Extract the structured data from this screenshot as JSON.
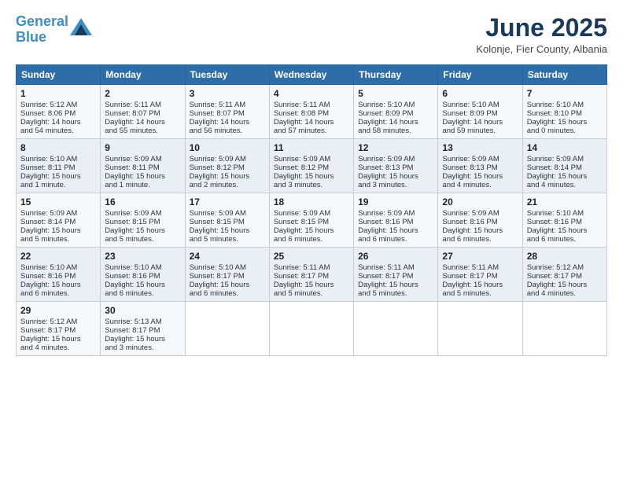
{
  "header": {
    "logo_line1": "General",
    "logo_line2": "Blue",
    "month": "June 2025",
    "location": "Kolonje, Fier County, Albania"
  },
  "days_of_week": [
    "Sunday",
    "Monday",
    "Tuesday",
    "Wednesday",
    "Thursday",
    "Friday",
    "Saturday"
  ],
  "weeks": [
    [
      {
        "day": "1",
        "lines": [
          "Sunrise: 5:12 AM",
          "Sunset: 8:06 PM",
          "Daylight: 14 hours",
          "and 54 minutes."
        ]
      },
      {
        "day": "2",
        "lines": [
          "Sunrise: 5:11 AM",
          "Sunset: 8:07 PM",
          "Daylight: 14 hours",
          "and 55 minutes."
        ]
      },
      {
        "day": "3",
        "lines": [
          "Sunrise: 5:11 AM",
          "Sunset: 8:07 PM",
          "Daylight: 14 hours",
          "and 56 minutes."
        ]
      },
      {
        "day": "4",
        "lines": [
          "Sunrise: 5:11 AM",
          "Sunset: 8:08 PM",
          "Daylight: 14 hours",
          "and 57 minutes."
        ]
      },
      {
        "day": "5",
        "lines": [
          "Sunrise: 5:10 AM",
          "Sunset: 8:09 PM",
          "Daylight: 14 hours",
          "and 58 minutes."
        ]
      },
      {
        "day": "6",
        "lines": [
          "Sunrise: 5:10 AM",
          "Sunset: 8:09 PM",
          "Daylight: 14 hours",
          "and 59 minutes."
        ]
      },
      {
        "day": "7",
        "lines": [
          "Sunrise: 5:10 AM",
          "Sunset: 8:10 PM",
          "Daylight: 15 hours",
          "and 0 minutes."
        ]
      }
    ],
    [
      {
        "day": "8",
        "lines": [
          "Sunrise: 5:10 AM",
          "Sunset: 8:11 PM",
          "Daylight: 15 hours",
          "and 1 minute."
        ]
      },
      {
        "day": "9",
        "lines": [
          "Sunrise: 5:09 AM",
          "Sunset: 8:11 PM",
          "Daylight: 15 hours",
          "and 1 minute."
        ]
      },
      {
        "day": "10",
        "lines": [
          "Sunrise: 5:09 AM",
          "Sunset: 8:12 PM",
          "Daylight: 15 hours",
          "and 2 minutes."
        ]
      },
      {
        "day": "11",
        "lines": [
          "Sunrise: 5:09 AM",
          "Sunset: 8:12 PM",
          "Daylight: 15 hours",
          "and 3 minutes."
        ]
      },
      {
        "day": "12",
        "lines": [
          "Sunrise: 5:09 AM",
          "Sunset: 8:13 PM",
          "Daylight: 15 hours",
          "and 3 minutes."
        ]
      },
      {
        "day": "13",
        "lines": [
          "Sunrise: 5:09 AM",
          "Sunset: 8:13 PM",
          "Daylight: 15 hours",
          "and 4 minutes."
        ]
      },
      {
        "day": "14",
        "lines": [
          "Sunrise: 5:09 AM",
          "Sunset: 8:14 PM",
          "Daylight: 15 hours",
          "and 4 minutes."
        ]
      }
    ],
    [
      {
        "day": "15",
        "lines": [
          "Sunrise: 5:09 AM",
          "Sunset: 8:14 PM",
          "Daylight: 15 hours",
          "and 5 minutes."
        ]
      },
      {
        "day": "16",
        "lines": [
          "Sunrise: 5:09 AM",
          "Sunset: 8:15 PM",
          "Daylight: 15 hours",
          "and 5 minutes."
        ]
      },
      {
        "day": "17",
        "lines": [
          "Sunrise: 5:09 AM",
          "Sunset: 8:15 PM",
          "Daylight: 15 hours",
          "and 5 minutes."
        ]
      },
      {
        "day": "18",
        "lines": [
          "Sunrise: 5:09 AM",
          "Sunset: 8:15 PM",
          "Daylight: 15 hours",
          "and 6 minutes."
        ]
      },
      {
        "day": "19",
        "lines": [
          "Sunrise: 5:09 AM",
          "Sunset: 8:16 PM",
          "Daylight: 15 hours",
          "and 6 minutes."
        ]
      },
      {
        "day": "20",
        "lines": [
          "Sunrise: 5:09 AM",
          "Sunset: 8:16 PM",
          "Daylight: 15 hours",
          "and 6 minutes."
        ]
      },
      {
        "day": "21",
        "lines": [
          "Sunrise: 5:10 AM",
          "Sunset: 8:16 PM",
          "Daylight: 15 hours",
          "and 6 minutes."
        ]
      }
    ],
    [
      {
        "day": "22",
        "lines": [
          "Sunrise: 5:10 AM",
          "Sunset: 8:16 PM",
          "Daylight: 15 hours",
          "and 6 minutes."
        ]
      },
      {
        "day": "23",
        "lines": [
          "Sunrise: 5:10 AM",
          "Sunset: 8:16 PM",
          "Daylight: 15 hours",
          "and 6 minutes."
        ]
      },
      {
        "day": "24",
        "lines": [
          "Sunrise: 5:10 AM",
          "Sunset: 8:17 PM",
          "Daylight: 15 hours",
          "and 6 minutes."
        ]
      },
      {
        "day": "25",
        "lines": [
          "Sunrise: 5:11 AM",
          "Sunset: 8:17 PM",
          "Daylight: 15 hours",
          "and 5 minutes."
        ]
      },
      {
        "day": "26",
        "lines": [
          "Sunrise: 5:11 AM",
          "Sunset: 8:17 PM",
          "Daylight: 15 hours",
          "and 5 minutes."
        ]
      },
      {
        "day": "27",
        "lines": [
          "Sunrise: 5:11 AM",
          "Sunset: 8:17 PM",
          "Daylight: 15 hours",
          "and 5 minutes."
        ]
      },
      {
        "day": "28",
        "lines": [
          "Sunrise: 5:12 AM",
          "Sunset: 8:17 PM",
          "Daylight: 15 hours",
          "and 4 minutes."
        ]
      }
    ],
    [
      {
        "day": "29",
        "lines": [
          "Sunrise: 5:12 AM",
          "Sunset: 8:17 PM",
          "Daylight: 15 hours",
          "and 4 minutes."
        ]
      },
      {
        "day": "30",
        "lines": [
          "Sunrise: 5:13 AM",
          "Sunset: 8:17 PM",
          "Daylight: 15 hours",
          "and 3 minutes."
        ]
      },
      {
        "day": "",
        "lines": []
      },
      {
        "day": "",
        "lines": []
      },
      {
        "day": "",
        "lines": []
      },
      {
        "day": "",
        "lines": []
      },
      {
        "day": "",
        "lines": []
      }
    ]
  ]
}
